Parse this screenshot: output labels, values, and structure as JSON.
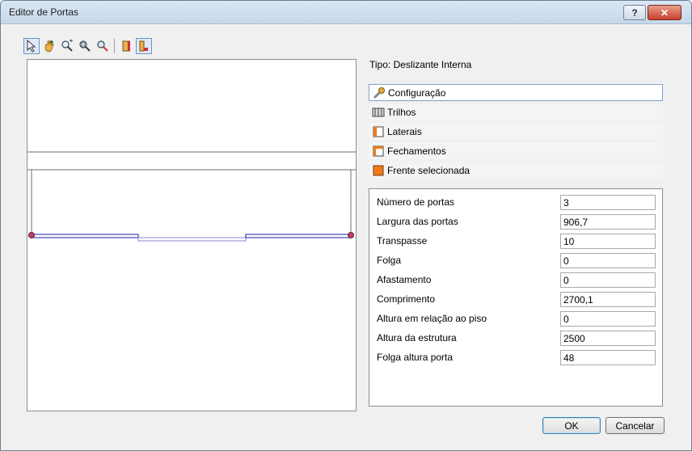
{
  "window": {
    "title": "Editor de Portas",
    "help_label": "?",
    "close_label": "✕"
  },
  "toolbar": {
    "tools": [
      "select-icon",
      "pan-icon",
      "zoom-extents-icon",
      "zoom-window-icon",
      "zoom-icon",
      "door-front-icon",
      "door-side-icon"
    ],
    "active_tool": "door-side-icon"
  },
  "tipo": "Tipo: Deslizante Interna",
  "sections": [
    {
      "label": "Configuração",
      "icon": "wrench-icon",
      "selected": true
    },
    {
      "label": "Trilhos",
      "icon": "rails-icon"
    },
    {
      "label": "Laterais",
      "icon": "laterals-icon"
    },
    {
      "label": "Fechamentos",
      "icon": "closings-icon"
    },
    {
      "label": "Frente selecionada",
      "icon": "front-icon"
    }
  ],
  "properties": [
    {
      "label": "Número de portas",
      "value": "3"
    },
    {
      "label": "Largura das portas",
      "value": "906,7"
    },
    {
      "label": "Transpasse",
      "value": "10"
    },
    {
      "label": "Folga",
      "value": "0"
    },
    {
      "label": "Afastamento",
      "value": "0"
    },
    {
      "label": "Comprimento",
      "value": "2700,1"
    },
    {
      "label": "Altura em relação ao piso",
      "value": "0"
    },
    {
      "label": "Altura da estrutura",
      "value": "2500"
    },
    {
      "label": "Folga altura porta",
      "value": "48"
    }
  ],
  "buttons": {
    "ok": "OK",
    "cancel": "Cancelar"
  },
  "colors": {
    "door_line": "#1f1f9e",
    "hinge": "#c0406a"
  }
}
